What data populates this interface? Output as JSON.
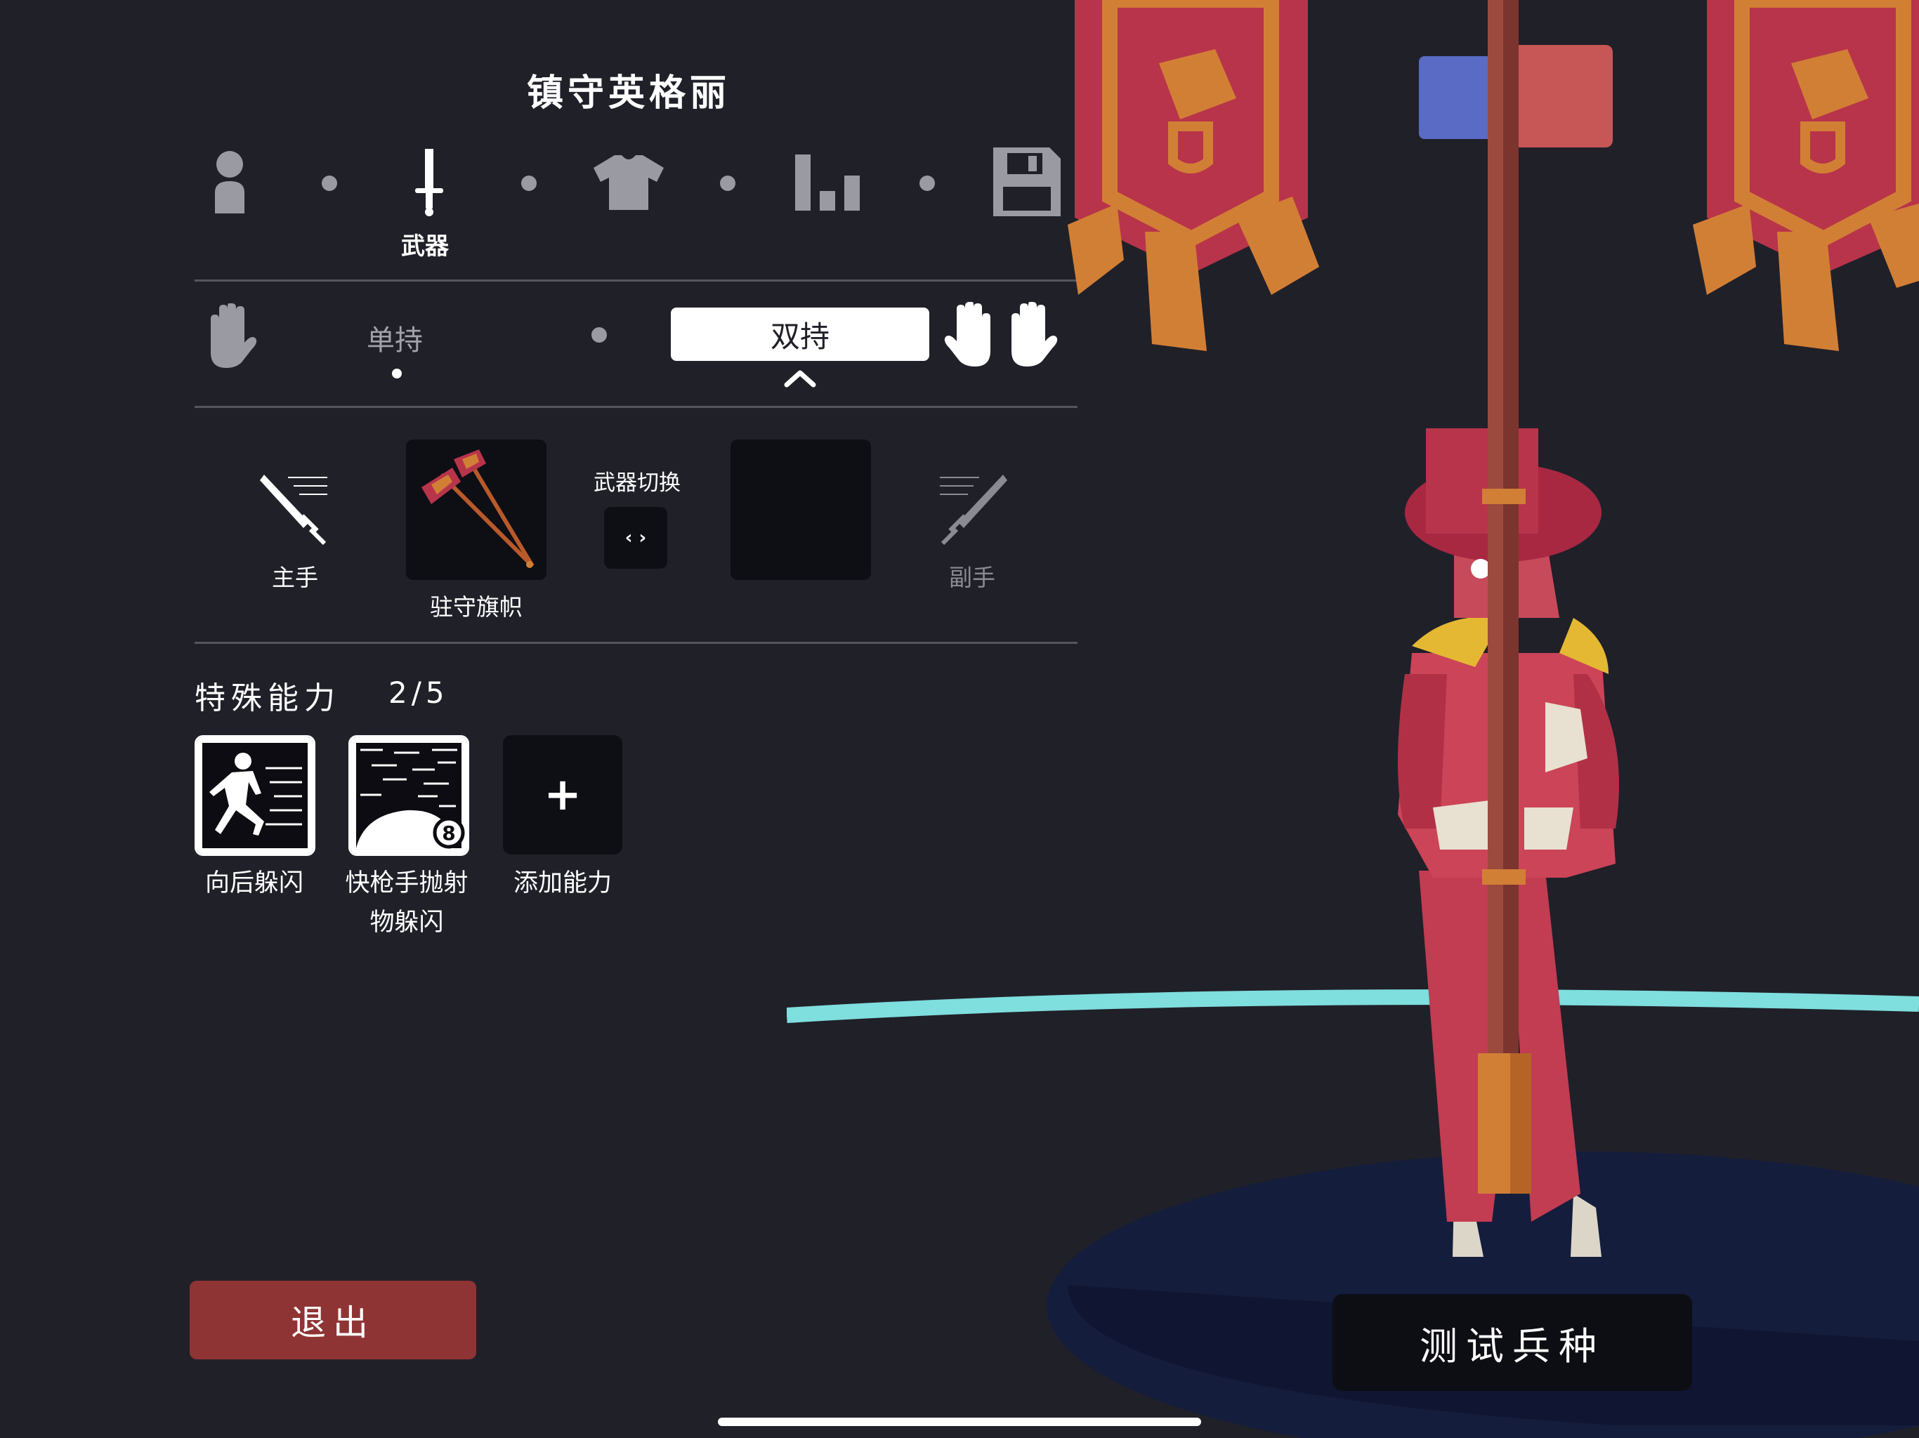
{
  "unit": {
    "title": "镇守英格丽"
  },
  "nav_steps": [
    {
      "icon": "person-icon",
      "label": ""
    },
    {
      "icon": "sword-icon",
      "label": "武器"
    },
    {
      "icon": "shirt-icon",
      "label": ""
    },
    {
      "icon": "stats-bars-icon",
      "label": ""
    },
    {
      "icon": "save-disk-icon",
      "label": ""
    }
  ],
  "grip": {
    "single_label": "单持",
    "dual_label": "双持",
    "selected": "双持"
  },
  "weapons": {
    "main_hand_label": "主手",
    "main_weapon_name": "驻守旗帜",
    "switch_label": "武器切换",
    "switch_icon": "‹ ›",
    "off_hand_label": "副手"
  },
  "abilities": {
    "title": "特殊能力",
    "count": "2/5",
    "items": [
      {
        "label": "向后躲闪",
        "icon": "dodge-back-icon"
      },
      {
        "label_line1": "快枪手抛射",
        "label_line2": "物躲闪",
        "icon": "projectile-dodge-icon"
      },
      {
        "label": "添加能力",
        "icon": "plus-icon"
      }
    ],
    "add_symbol": "+"
  },
  "buttons": {
    "exit": "退出",
    "test_unit": "测试兵种"
  },
  "colors": {
    "background": "#202029",
    "exit_button": "#8f3434",
    "team_blue": "#5a6bc6",
    "team_red": "#c75656",
    "banner_red": "#b8344a",
    "banner_orange": "#d27f36",
    "arena_cyan": "#7fdede"
  }
}
